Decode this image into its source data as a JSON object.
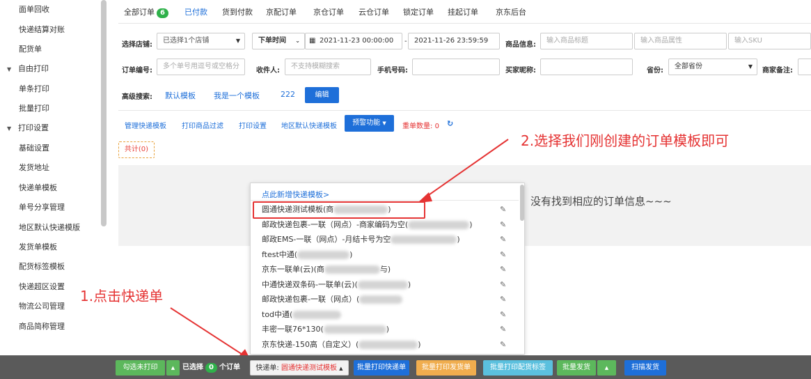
{
  "sidebar": {
    "items": [
      {
        "label": "面单回收",
        "type": "child"
      },
      {
        "label": "快递结算对账",
        "type": "child"
      },
      {
        "label": "配货单",
        "type": "child"
      },
      {
        "label": "自由打印",
        "type": "group"
      },
      {
        "label": "单条打印",
        "type": "child"
      },
      {
        "label": "批量打印",
        "type": "child"
      },
      {
        "label": "打印设置",
        "type": "group"
      },
      {
        "label": "基础设置",
        "type": "child"
      },
      {
        "label": "发货地址",
        "type": "child"
      },
      {
        "label": "快递单模板",
        "type": "child"
      },
      {
        "label": "单号分享管理",
        "type": "child"
      },
      {
        "label": "地区默认快递模版",
        "type": "child"
      },
      {
        "label": "发货单模板",
        "type": "child"
      },
      {
        "label": "配货标签模板",
        "type": "child"
      },
      {
        "label": "快递超区设置",
        "type": "child"
      },
      {
        "label": "物流公司管理",
        "type": "child"
      },
      {
        "label": "商品简称管理",
        "type": "child"
      }
    ]
  },
  "tabs": {
    "all": "全部订单",
    "all_count": "6",
    "paid": "已付款",
    "cod": "货到付款",
    "jd_dist": "京配订单",
    "jd_warehouse": "京仓订单",
    "cloud": "云仓订单",
    "locked": "锁定订单",
    "hung": "挂起订单",
    "jd_backend": "京东后台"
  },
  "filters": {
    "shop_label": "选择店铺:",
    "shop_value": "已选择1个店铺",
    "time_type": "下单时间",
    "date_start": "2021-11-23 00:00:00",
    "date_sep": "-",
    "date_end": "2021-11-26 23:59:59",
    "goods_label": "商品信息:",
    "goods_title_ph": "输入商品标题",
    "goods_attr_ph": "输入商品属性",
    "goods_sku_ph": "输入SKU",
    "order_no_label": "订单编号:",
    "order_no_ph": "多个单号用逗号或空格分",
    "receiver_label": "收件人:",
    "receiver_ph": "不支持模糊搜索",
    "phone_label": "手机号码:",
    "buyer_label": "买家昵称:",
    "province_label": "省份:",
    "province_value": "全部省份",
    "merchant_note_label": "商家备注:"
  },
  "advanced": {
    "label": "高级搜索:",
    "default_tpl": "默认模板",
    "my_tpl": "我是一个模板",
    "tpl_222": "222",
    "edit_btn": "编辑"
  },
  "toolbar": {
    "manage_express": "管理快递模板",
    "print_filter": "打印商品过滤",
    "print_settings": "打印设置",
    "region_default": "地区默认快递模板",
    "warn_btn": "预警功能",
    "dup_label": "重单数量:",
    "dup_count": "0"
  },
  "total_label": "共计(0)",
  "empty_text": "没有找到相应的订单信息~~~",
  "dropdown": {
    "add_new": "点此新增快递模板>",
    "items": [
      {
        "text": "圆通快递测试模板(商",
        "tail": ")"
      },
      {
        "text": "邮政快递包裹-一联（网点）-商家编码为空(",
        "tail": ")"
      },
      {
        "text": "邮政EMS-一联（网点）-月结卡号为空",
        "tail": ")"
      },
      {
        "text": "ftest中通(",
        "tail": ")"
      },
      {
        "text": "京东一联单(云)(商",
        "tail": "与)"
      },
      {
        "text": "中通快递双条码-一联单(云)(",
        "tail": ")"
      },
      {
        "text": "邮政快递包裹-一联（网点）(",
        "tail": ""
      },
      {
        "text": "tod中通(",
        "tail": ""
      },
      {
        "text": "丰密一联76*130(",
        "tail": ")"
      },
      {
        "text": "京东快递-150高（自定义）(",
        "tail": ")"
      }
    ]
  },
  "annotations": {
    "step1": "1.点击快递单",
    "step2": "2.选择我们刚创建的订单模板即可"
  },
  "bottombar": {
    "select_unprinted": "勾选未打印",
    "selected_prefix": "已选择",
    "selected_count": "0",
    "selected_suffix": "个订单",
    "express_label": "快递单:",
    "express_value": "圆通快递测试模板",
    "batch_print_express": "批量打印快递单",
    "batch_print_delivery": "批量打印发货单",
    "batch_print_labels": "批量打印配货标签",
    "batch_ship": "批量发货",
    "scan_ship": "扫描发货"
  },
  "colors": {
    "accent": "#1e6fd9",
    "green": "#5cb85c",
    "orange": "#f0ad4e",
    "cyan": "#5bc0de",
    "red": "#e53333"
  }
}
